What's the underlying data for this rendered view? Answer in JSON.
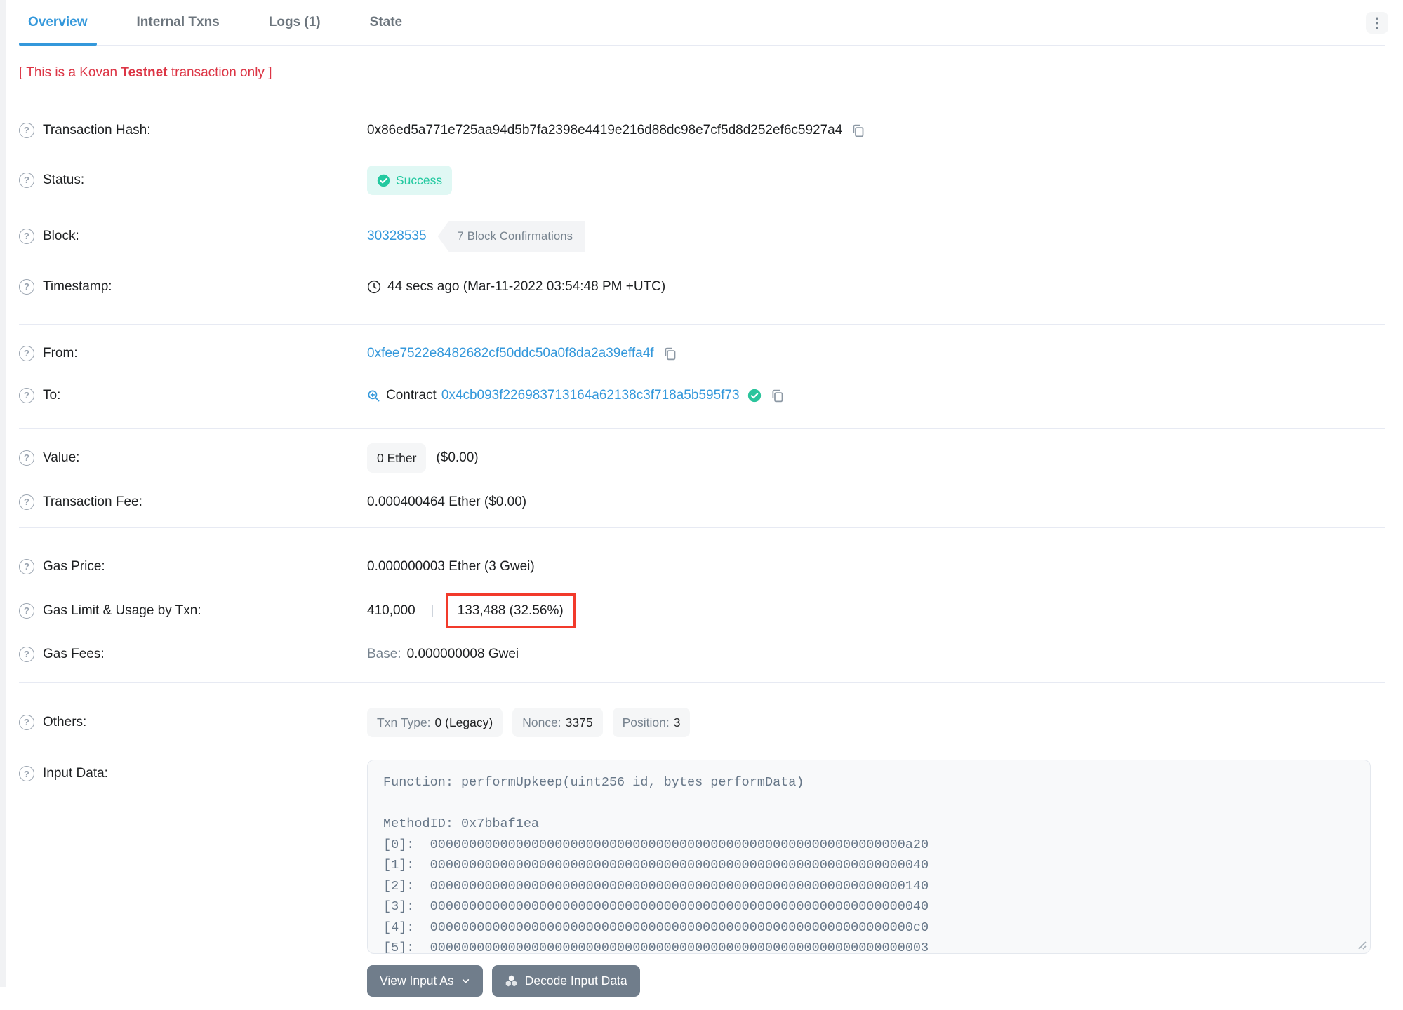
{
  "tabs": {
    "overview": "Overview",
    "internal_txns": "Internal Txns",
    "logs": "Logs (1)",
    "state": "State"
  },
  "icons": {
    "help": "?",
    "kebab": "⋮"
  },
  "warning": {
    "prefix": "[ This is a Kovan ",
    "emphasis": "Testnet",
    "suffix": " transaction only ]"
  },
  "transaction": {
    "hash_label": "Transaction Hash:",
    "hash": "0x86ed5a771e725aa94d5b7fa2398e4419e216d88dc98e7cf5d8d252ef6c5927a4",
    "status_label": "Status:",
    "status": "Success",
    "block_label": "Block:",
    "block": "30328535",
    "confirmations": "7 Block Confirmations",
    "timestamp_label": "Timestamp:",
    "timestamp": "44 secs ago (Mar-11-2022 03:54:48 PM +UTC)",
    "from_label": "From:",
    "from": "0xfee7522e8482682cf50ddc50a0f8da2a39effa4f",
    "to_label": "To:",
    "to_type": "Contract",
    "to": "0x4cb093f226983713164a62138c3f718a5b595f73",
    "value_label": "Value:",
    "value": "0 Ether",
    "value_usd": "($0.00)",
    "fee_label": "Transaction Fee:",
    "fee": "0.000400464 Ether ($0.00)",
    "gas_price_label": "Gas Price:",
    "gas_price": "0.000000003 Ether (3 Gwei)",
    "gas_limit_label": "Gas Limit & Usage by Txn:",
    "gas_limit": "410,000",
    "gas_separator": "|",
    "gas_usage": "133,488 (32.56%)",
    "gas_fees_label": "Gas Fees:",
    "base_label": "Base:",
    "base_value": "0.000000008 Gwei",
    "others_label": "Others:",
    "txn_type_label": "Txn Type:",
    "txn_type": "0 (Legacy)",
    "nonce_label": "Nonce:",
    "nonce": "3375",
    "position_label": "Position:",
    "position": "3"
  },
  "input_data": {
    "label": "Input Data:",
    "function_line": "Function: performUpkeep(uint256 id, bytes performData)",
    "method_id_line": "MethodID: 0x7bbaf1ea",
    "params": [
      "[0]:  0000000000000000000000000000000000000000000000000000000000000a20",
      "[1]:  0000000000000000000000000000000000000000000000000000000000000040",
      "[2]:  0000000000000000000000000000000000000000000000000000000000000140",
      "[3]:  0000000000000000000000000000000000000000000000000000000000000040",
      "[4]:  00000000000000000000000000000000000000000000000000000000000000c0",
      "[5]:  0000000000000000000000000000000000000000000000000000000000000003"
    ]
  },
  "buttons": {
    "view_input_as": "View Input As",
    "decode_input_data": "Decode Input Data"
  },
  "colors": {
    "link": "#3498db",
    "success": "#00c9a7",
    "danger": "#dc3545",
    "highlight": "#f23a2b"
  }
}
